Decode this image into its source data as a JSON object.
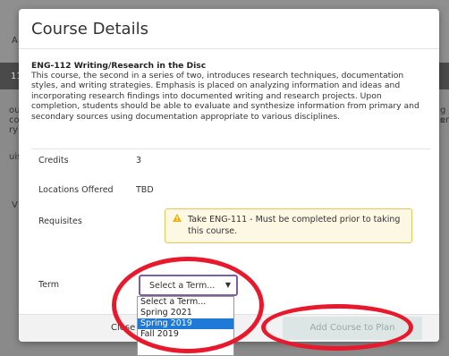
{
  "background": {
    "fragments": [
      "A",
      "11",
      "ou",
      "co",
      "ry",
      "uis",
      "V",
      "g s",
      "en"
    ]
  },
  "modal": {
    "title": "Course Details",
    "course_name": "ENG-112 Writing/Research in the Disc",
    "description": "This course, the second in a series of two, introduces research techniques, documentation styles, and writing strategies. Emphasis is placed on analyzing information and ideas and incorporating research findings into documented writing and research projects. Upon completion, students should be able to evaluate and synthesize information from primary and secondary sources using documentation appropriate to various disciplines.",
    "rows": {
      "credits_label": "Credits",
      "credits_value": "3",
      "locations_label": "Locations Offered",
      "locations_value": "TBD",
      "requisites_label": "Requisites",
      "requisite_text": "Take ENG-111 - Must be completed prior to taking this course.",
      "term_label": "Term"
    },
    "term_select": {
      "value": "Select a Term...",
      "options": [
        "Select a Term...",
        "Spring 2021",
        "Spring 2019",
        "Fall 2019"
      ],
      "highlighted_index": 2
    },
    "footer": {
      "close_label": "Close",
      "add_label": "Add Course to Plan"
    }
  },
  "colors": {
    "annotation_red": "#e8192c",
    "warning_icon": "#f0b400",
    "select_border": "#7b5ea7",
    "option_highlight": "#1e7ad6"
  },
  "icons": {
    "warning": "warning-triangle-icon",
    "select_arrow": "caret-down-icon"
  }
}
